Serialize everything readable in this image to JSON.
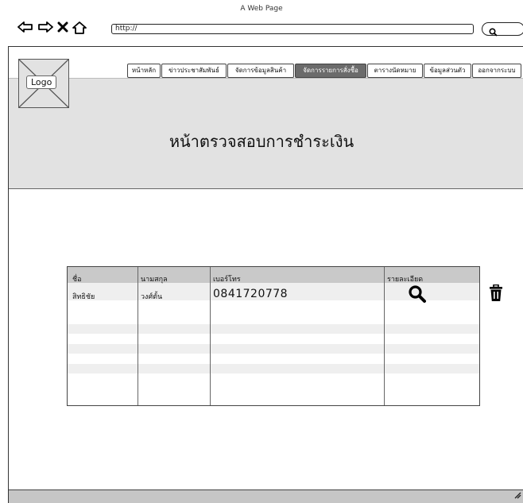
{
  "browser": {
    "window_title": "A Web Page",
    "url": "http://",
    "icons": [
      "back-arrow-icon",
      "forward-arrow-icon",
      "close-x-icon",
      "home-icon",
      "search-icon"
    ]
  },
  "header": {
    "logo_label": "Logo",
    "title": "หน้าตรวจสอบการชำระเงิน",
    "background_color": "#e2e2e2"
  },
  "menu": {
    "items": [
      {
        "label": "หน้าหลัก",
        "active": false
      },
      {
        "label": "ข่าวประชาสัมพันธ์",
        "active": false
      },
      {
        "label": "จัดการข้อมูลสินค้า",
        "active": false
      },
      {
        "label": "จัดการรายการสั่งซื้อ",
        "active": true
      },
      {
        "label": "ตารางนัดหมาย",
        "active": false
      },
      {
        "label": "ข้อมูลส่วนตัว",
        "active": false
      },
      {
        "label": "ออกจากระบบ",
        "active": false
      }
    ],
    "active_color": "#6b6b6b"
  },
  "table": {
    "columns": [
      "ชื่อ",
      "นามสกุล",
      "เบอร์โทร",
      "รายละเอียด"
    ],
    "rows": [
      {
        "first_name": "สิทธิชัย",
        "last_name": "วงศ์ตั้น",
        "phone": "0841720778",
        "detail_icon": "magnifier-icon"
      }
    ],
    "empty_rows": 5,
    "header_color": "#c9c9c9"
  },
  "actions": {
    "delete_icon": "trash-icon"
  }
}
